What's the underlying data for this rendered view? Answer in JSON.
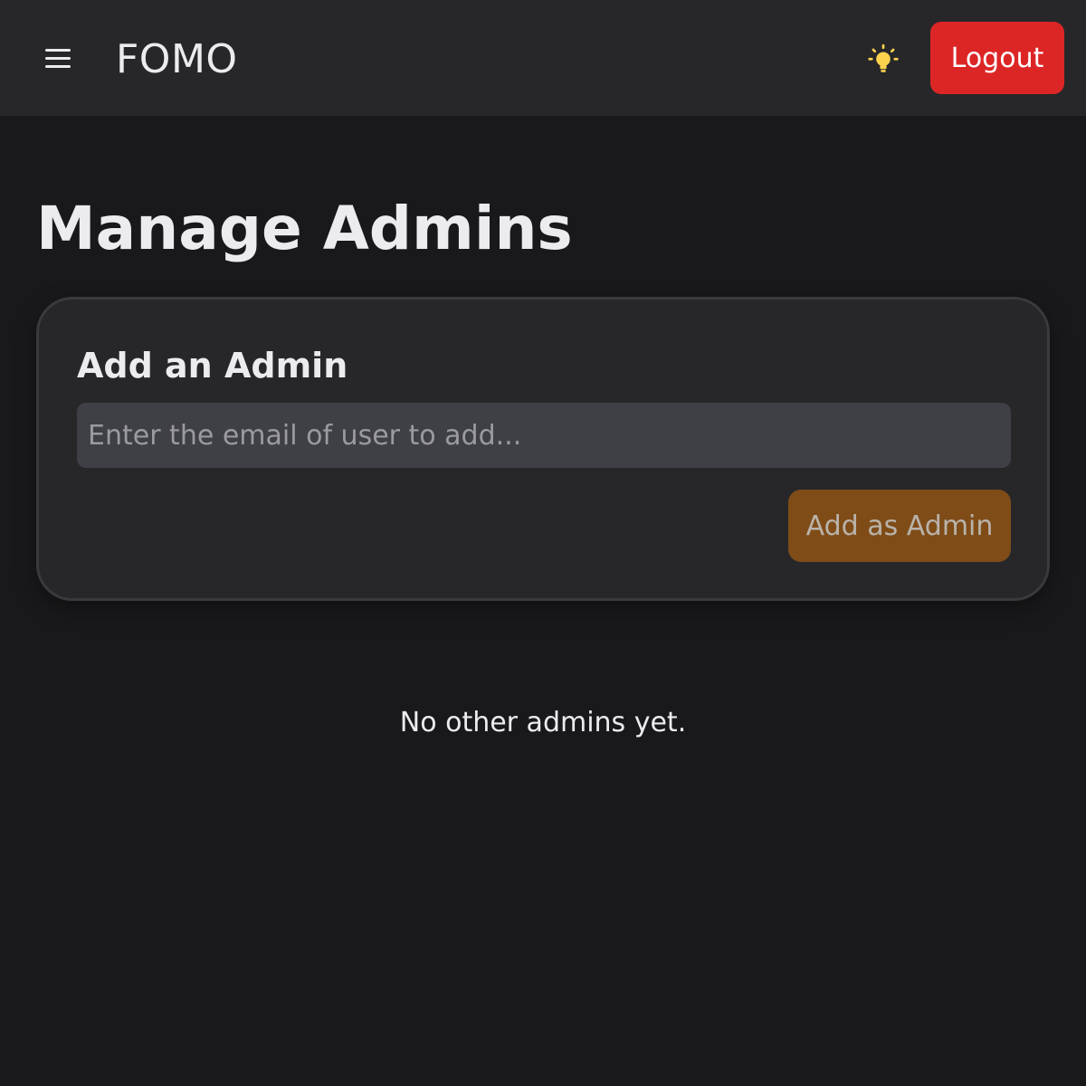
{
  "header": {
    "brand": "FOMO",
    "menu_icon": "hamburger-menu-icon",
    "theme_icon": "lightbulb-icon",
    "theme_icon_color": "#fcd34d",
    "logout_label": "Logout",
    "logout_color": "#dc2626"
  },
  "main": {
    "title": "Manage Admins",
    "add_card": {
      "title": "Add an Admin",
      "email_value": "",
      "email_placeholder": "Enter the email of user to add...",
      "submit_label": "Add as Admin",
      "submit_color": "#7f4c18"
    },
    "empty_message": "No other admins yet."
  },
  "theme": {
    "background": "#19191b",
    "surface": "#27272a",
    "input_background": "#3f3f46"
  }
}
